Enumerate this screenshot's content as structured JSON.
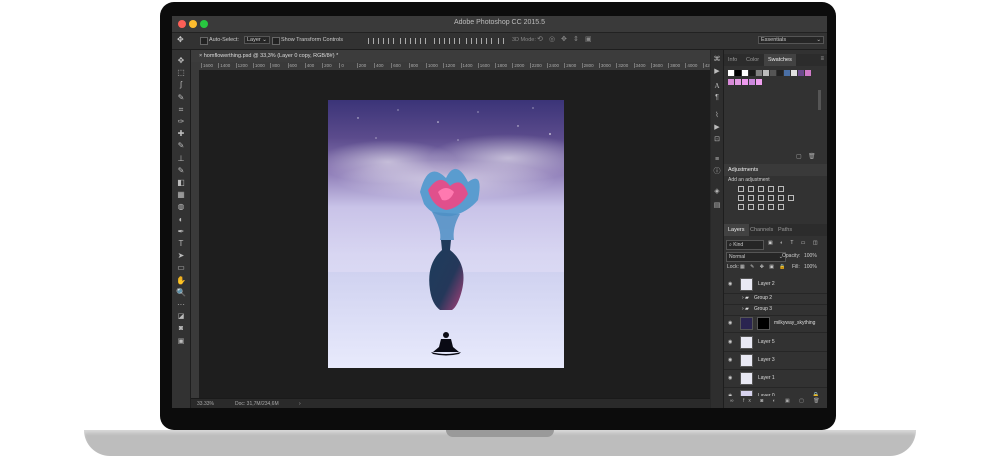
{
  "app": {
    "title": "Adobe Photoshop CC 2015.5",
    "workspace": "Essentials"
  },
  "options_bar": {
    "auto_select_label": "Auto-Select:",
    "auto_select_value": "Layer",
    "show_transform_label": "Show Transform Controls",
    "mode_3d_label": "3D Mode:"
  },
  "document": {
    "tab_title": "homflowerthing.psd @ 33,3% (Layer 0 copy, RGB/8#) *",
    "zoom": "33.33%",
    "doc_info": "Doc: 31,7M/234,6M",
    "ruler_ticks": [
      "1600",
      "1400",
      "1200",
      "1000",
      "800",
      "600",
      "400",
      "200",
      "0",
      "200",
      "400",
      "600",
      "800",
      "1000",
      "1200",
      "1400",
      "1600",
      "1800",
      "2000",
      "2200",
      "2400",
      "2600",
      "2800",
      "3000",
      "3200",
      "3400",
      "3600",
      "3800",
      "4000",
      "4200",
      "4400"
    ]
  },
  "panels": {
    "top_tabs": [
      "Info",
      "Color",
      "Swatches"
    ],
    "active_top_tab": "Swatches",
    "adjustments_title": "Adjustments",
    "adjustments_hint": "Add an adjustment",
    "layer_tabs": [
      "Layers",
      "Channels",
      "Paths"
    ],
    "filter_kind": "Kind",
    "blend_mode": "Normal",
    "opacity_label": "Opacity:",
    "opacity_value": "100%",
    "lock_label": "Lock:",
    "fill_label": "Fill:",
    "fill_value": "100%",
    "layers": [
      {
        "name": "Layer 2",
        "type": "layer"
      },
      {
        "name": "Group 2",
        "type": "group"
      },
      {
        "name": "Group 3",
        "type": "group"
      },
      {
        "name": "milkyway_skything",
        "type": "masked"
      },
      {
        "name": "Layer 5",
        "type": "layer"
      },
      {
        "name": "Layer 3",
        "type": "layer"
      },
      {
        "name": "Layer 1",
        "type": "layer"
      },
      {
        "name": "Layer 0",
        "type": "locked"
      }
    ]
  },
  "colors": {
    "swatches_row1": [
      "#ffffff",
      "#000000",
      "#ffffff",
      "#1a1a1a",
      "#808080",
      "#bdbdbd",
      "#555555",
      "#222222",
      "#4a6fa5",
      "#e0e0e0",
      "#6b4a8c",
      "#d07ac8"
    ],
    "swatches_row2": [
      "#d88ad8",
      "#e49be4",
      "#ee9aee",
      "#cc88dd",
      "#f0a0f0"
    ]
  },
  "icons": {
    "toolbar": [
      "move-icon",
      "marquee-icon",
      "lasso-icon",
      "quick-select-icon",
      "crop-icon",
      "eyedropper-icon",
      "healing-icon",
      "brush-icon",
      "stamp-icon",
      "history-brush-icon",
      "eraser-icon",
      "gradient-icon",
      "blur-icon",
      "dodge-icon",
      "pen-icon",
      "type-icon",
      "path-select-icon",
      "shape-icon",
      "hand-icon",
      "zoom-icon",
      "more-icon",
      "color-swap-icon",
      "quick-mask-icon",
      "screen-mode-icon"
    ],
    "toolbar_glyphs": [
      "✥",
      "⬚",
      "ʃ",
      "✎",
      "⌗",
      "✑",
      "✚",
      "✎",
      "⊥",
      "✎",
      "◧",
      "▦",
      "◍",
      "◐",
      "✒",
      "T",
      "➤",
      "▭",
      "✋",
      "🔍",
      "···",
      "◪",
      "◙",
      "▣"
    ]
  }
}
